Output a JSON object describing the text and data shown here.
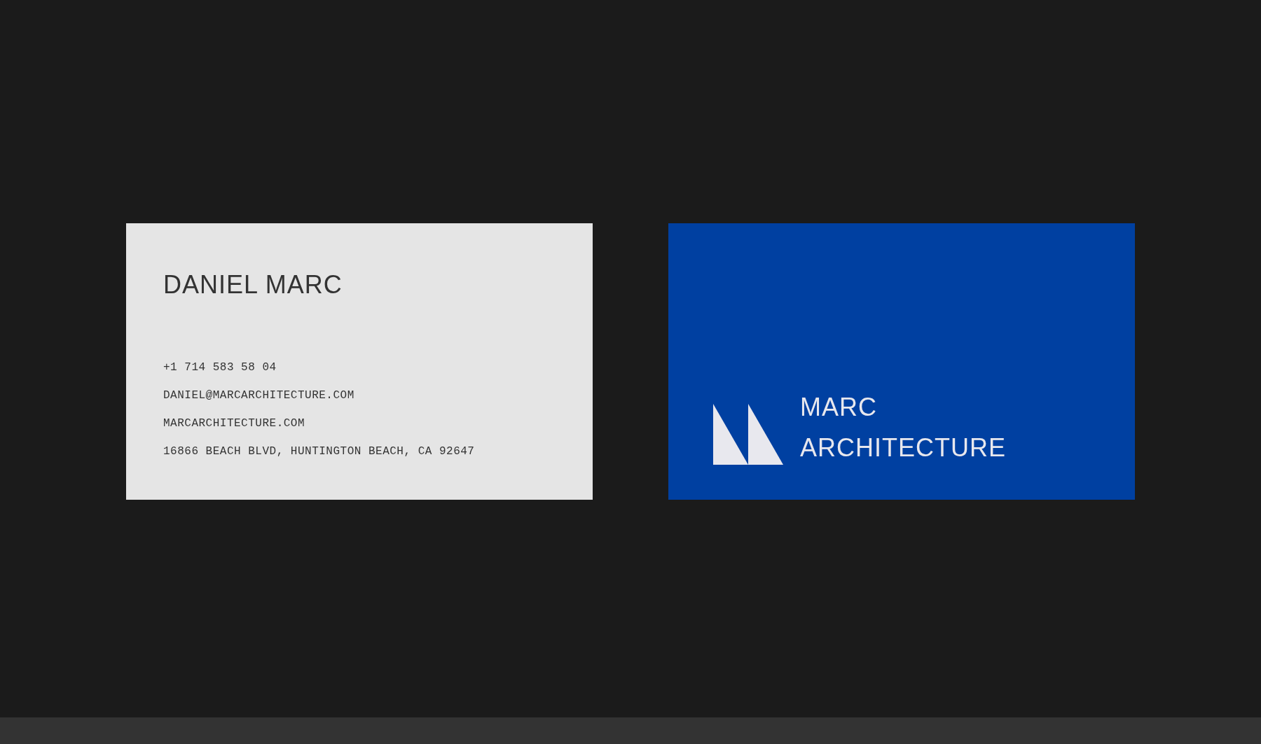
{
  "front_card": {
    "name": "DANIEL MARC",
    "contacts": [
      "+1 714 583 58 04",
      "DANIEL@MARCARCHITECTURE.COM",
      "MARCARCHITECTURE.COM",
      "16866 BEACH BLVD, HUNTINGTON BEACH, CA 92647"
    ]
  },
  "back_card": {
    "logo_lines": [
      "MARC",
      "ARCHITECTURE"
    ]
  }
}
